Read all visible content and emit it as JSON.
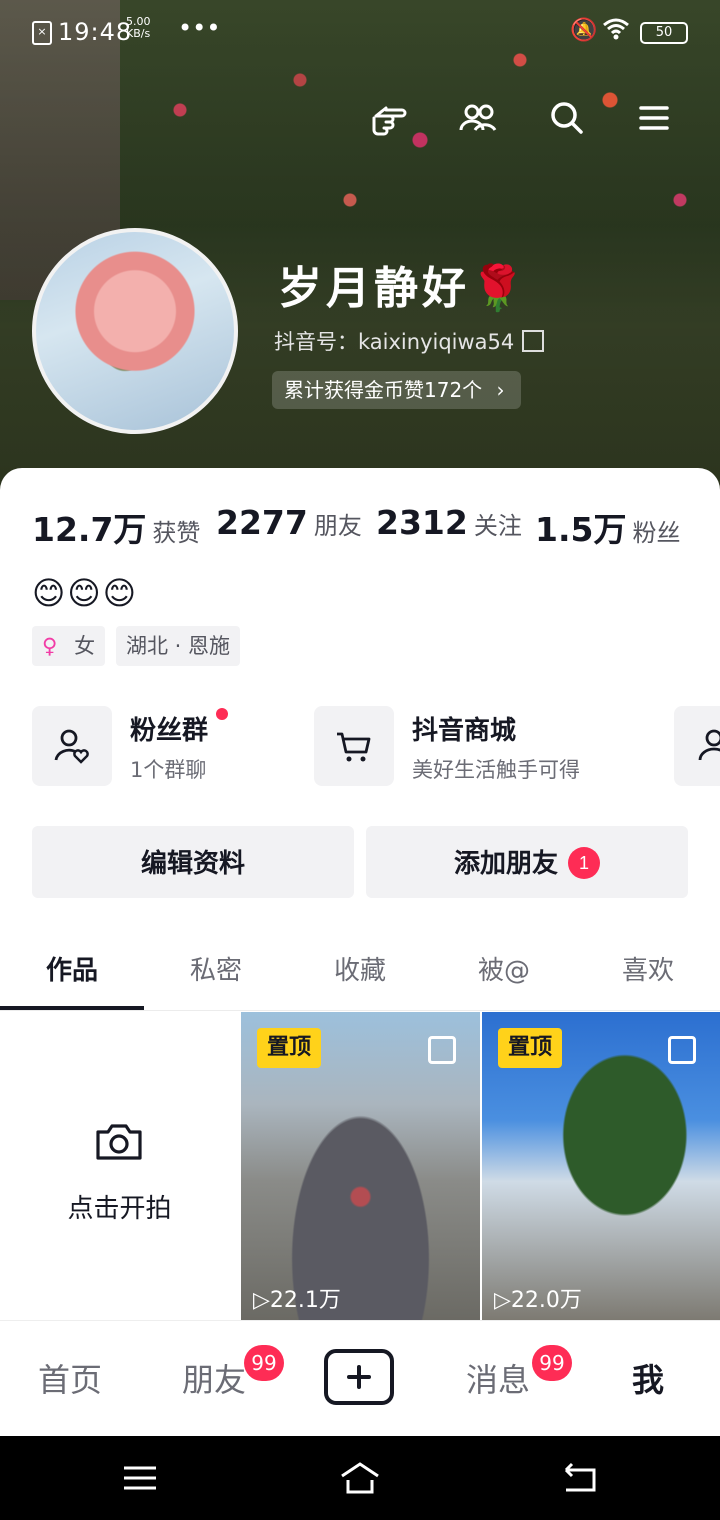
{
  "status_bar": {
    "time": "19:48",
    "net_speed": "5.00\nKB/s",
    "more": "•••",
    "battery": "50"
  },
  "profile": {
    "name": "岁月静好🌹",
    "douyin_id": "抖音号：kaixinyiqiwa54",
    "coin_text": "累计获得金币赞172个",
    "stats": [
      {
        "value": "12.7万",
        "label": "获赞"
      },
      {
        "value": "2277",
        "label": "朋友"
      },
      {
        "value": "2312",
        "label": "关注"
      },
      {
        "value": "1.5万",
        "label": "粉丝"
      }
    ],
    "bio_emojis": "😊😊😊",
    "tags": {
      "gender": "女",
      "location": "湖北 · 恩施"
    }
  },
  "features": [
    {
      "title": "粉丝群",
      "sub": "1个群聊"
    },
    {
      "title": "抖音商城",
      "sub": "美好生活触手可得"
    }
  ],
  "buttons": {
    "edit": "编辑资料",
    "add_friend": "添加朋友",
    "add_friend_badge": "1"
  },
  "tabs": [
    "作品",
    "私密",
    "收藏",
    "被@",
    "喜欢"
  ],
  "grid": {
    "shoot_label": "点击开拍",
    "videos": [
      {
        "pin": "置顶",
        "plays": "22.1万"
      },
      {
        "pin": "置顶",
        "plays": "22.0万"
      }
    ]
  },
  "bottom_nav": {
    "home": "首页",
    "friends": "朋友",
    "friends_badge": "99",
    "messages": "消息",
    "messages_badge": "99",
    "me": "我"
  }
}
